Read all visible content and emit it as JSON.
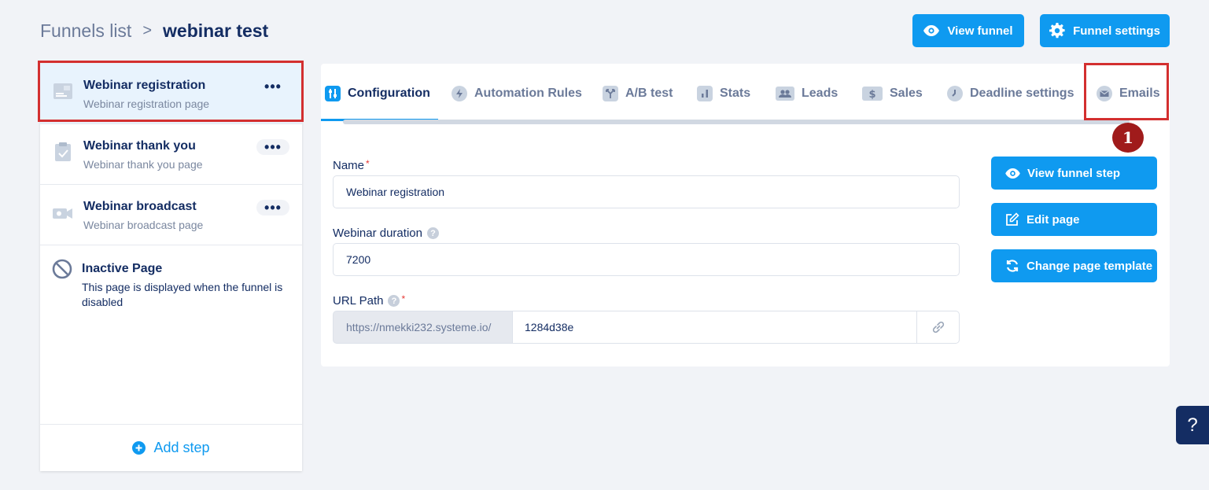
{
  "breadcrumb": {
    "parent": "Funnels list",
    "separator": ">",
    "current": "webinar test"
  },
  "header": {
    "view_funnel": "View funnel",
    "funnel_settings": "Funnel settings"
  },
  "sidebar": {
    "steps": [
      {
        "title": "Webinar registration",
        "subtitle": "Webinar registration page",
        "more": "•••",
        "icon": "page-icon"
      },
      {
        "title": "Webinar thank you",
        "subtitle": "Webinar thank you page",
        "more": "•••",
        "icon": "clipboard-check-icon"
      },
      {
        "title": "Webinar broadcast",
        "subtitle": "Webinar broadcast page",
        "more": "•••",
        "icon": "video-camera-icon"
      }
    ],
    "inactive": {
      "title": "Inactive Page",
      "description": "This page is displayed when the funnel is disabled"
    },
    "add_step": "Add step"
  },
  "tabs": [
    {
      "label": "Configuration",
      "icon": "sliders-icon",
      "active": true
    },
    {
      "label": "Automation Rules",
      "icon": "bolt-icon"
    },
    {
      "label": "A/B test",
      "icon": "split-icon"
    },
    {
      "label": "Stats",
      "icon": "bar-chart-icon"
    },
    {
      "label": "Leads",
      "icon": "users-icon"
    },
    {
      "label": "Sales",
      "icon": "dollar-icon"
    },
    {
      "label": "Deadline settings",
      "icon": "clock-icon"
    },
    {
      "label": "Emails",
      "icon": "envelope-icon"
    }
  ],
  "form": {
    "name_label": "Name",
    "name_value": "Webinar registration",
    "duration_label": "Webinar duration",
    "duration_value": "7200",
    "url_label": "URL Path",
    "url_prefix": "https://nmekki232.systeme.io/",
    "url_value": "1284d38e",
    "required_mark": "*",
    "help_mark": "?"
  },
  "actions": {
    "view_step": "View funnel step",
    "edit_page": "Edit page",
    "change_template": "Change page template"
  },
  "annotation": {
    "badge": "1"
  },
  "help_button": "?",
  "colors": {
    "accent": "#0f9af0",
    "navy": "#142d63",
    "annotation_red": "#d32f2f"
  }
}
